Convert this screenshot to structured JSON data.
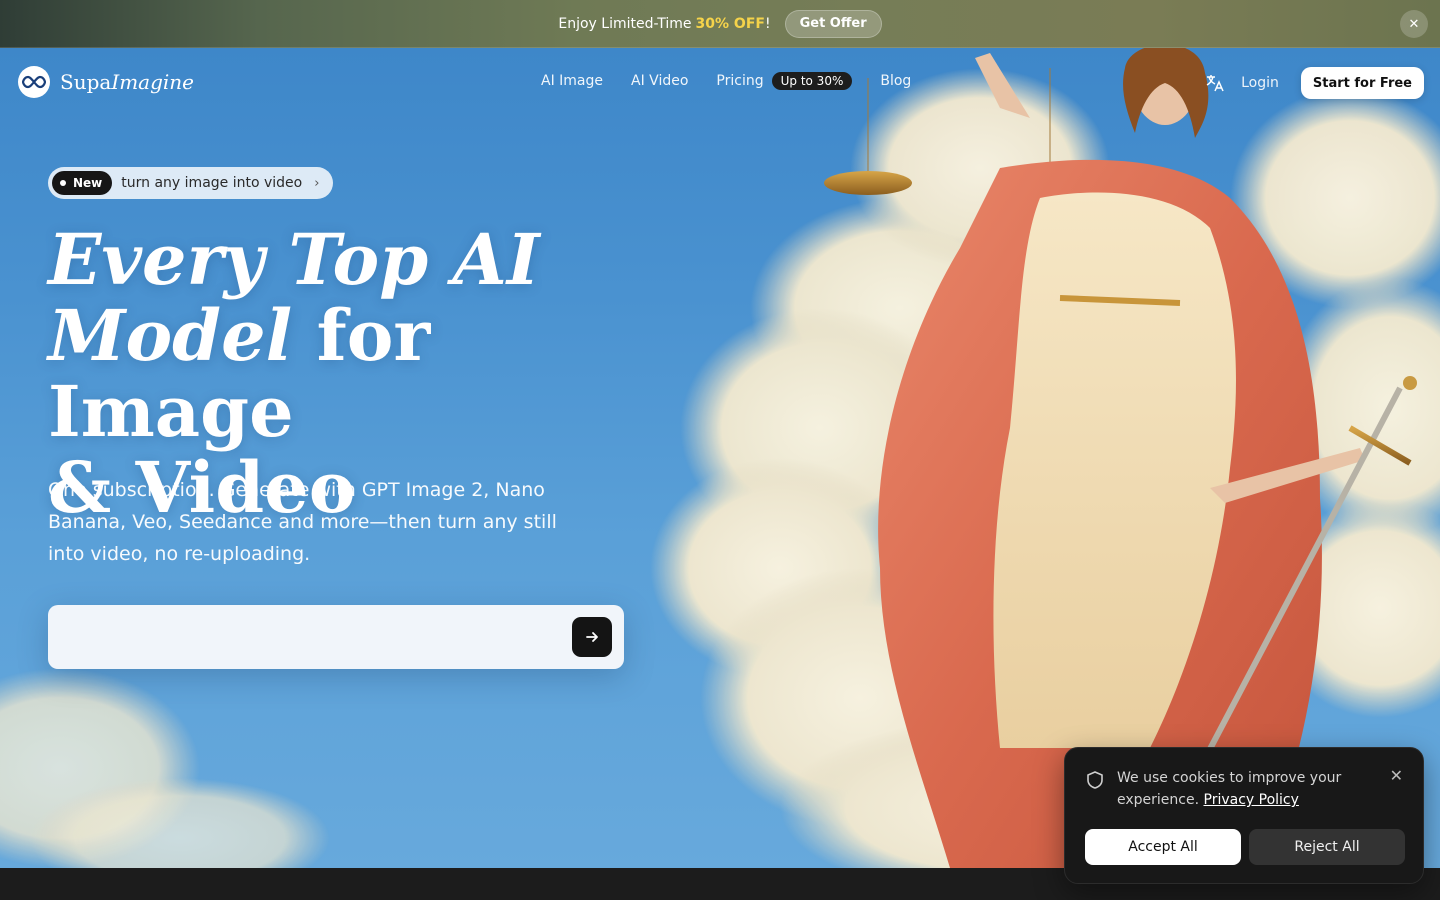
{
  "promo": {
    "text": "Enjoy Limited-Time",
    "highlight": "30% OFF",
    "suffix": "!",
    "button": "Get Offer",
    "close": "✕"
  },
  "header": {
    "brand_plain": "Supa",
    "brand_italic": "Imagine",
    "nav": [
      {
        "label": "AI Image"
      },
      {
        "label": "AI Video"
      },
      {
        "label": "Pricing",
        "badge": "Up to 30%"
      },
      {
        "label": "Blog"
      }
    ],
    "login": "Login",
    "cta": "Start for Free"
  },
  "hero": {
    "pill_badge": "New",
    "pill_text": "turn any image into video",
    "pill_chevron": "›",
    "headline_italic_1": "Every Top AI",
    "headline_italic_2": "Model",
    "headline_rest_2": " for Image",
    "headline_line_3": "& Video",
    "subtext": "One subscription. Generate with GPT Image 2, Nano Banana, Veo, Seedance and more—then turn any still into video, no re-uploading.",
    "prompt_value": "",
    "prompt_placeholder": ""
  },
  "cookie": {
    "text": "We use cookies to improve your experience.",
    "link": "Privacy Policy",
    "close": "✕",
    "accept": "Accept All",
    "reject": "Reject All"
  },
  "colors": {
    "promo_highlight": "#f5d34a",
    "sky": "#4a92d0",
    "cta_bg": "#ffffff",
    "dark": "#181818"
  },
  "icons": [
    "close-icon",
    "logo-icon",
    "translate-icon",
    "chevron-right-icon",
    "arrow-right-icon",
    "shield-icon"
  ]
}
